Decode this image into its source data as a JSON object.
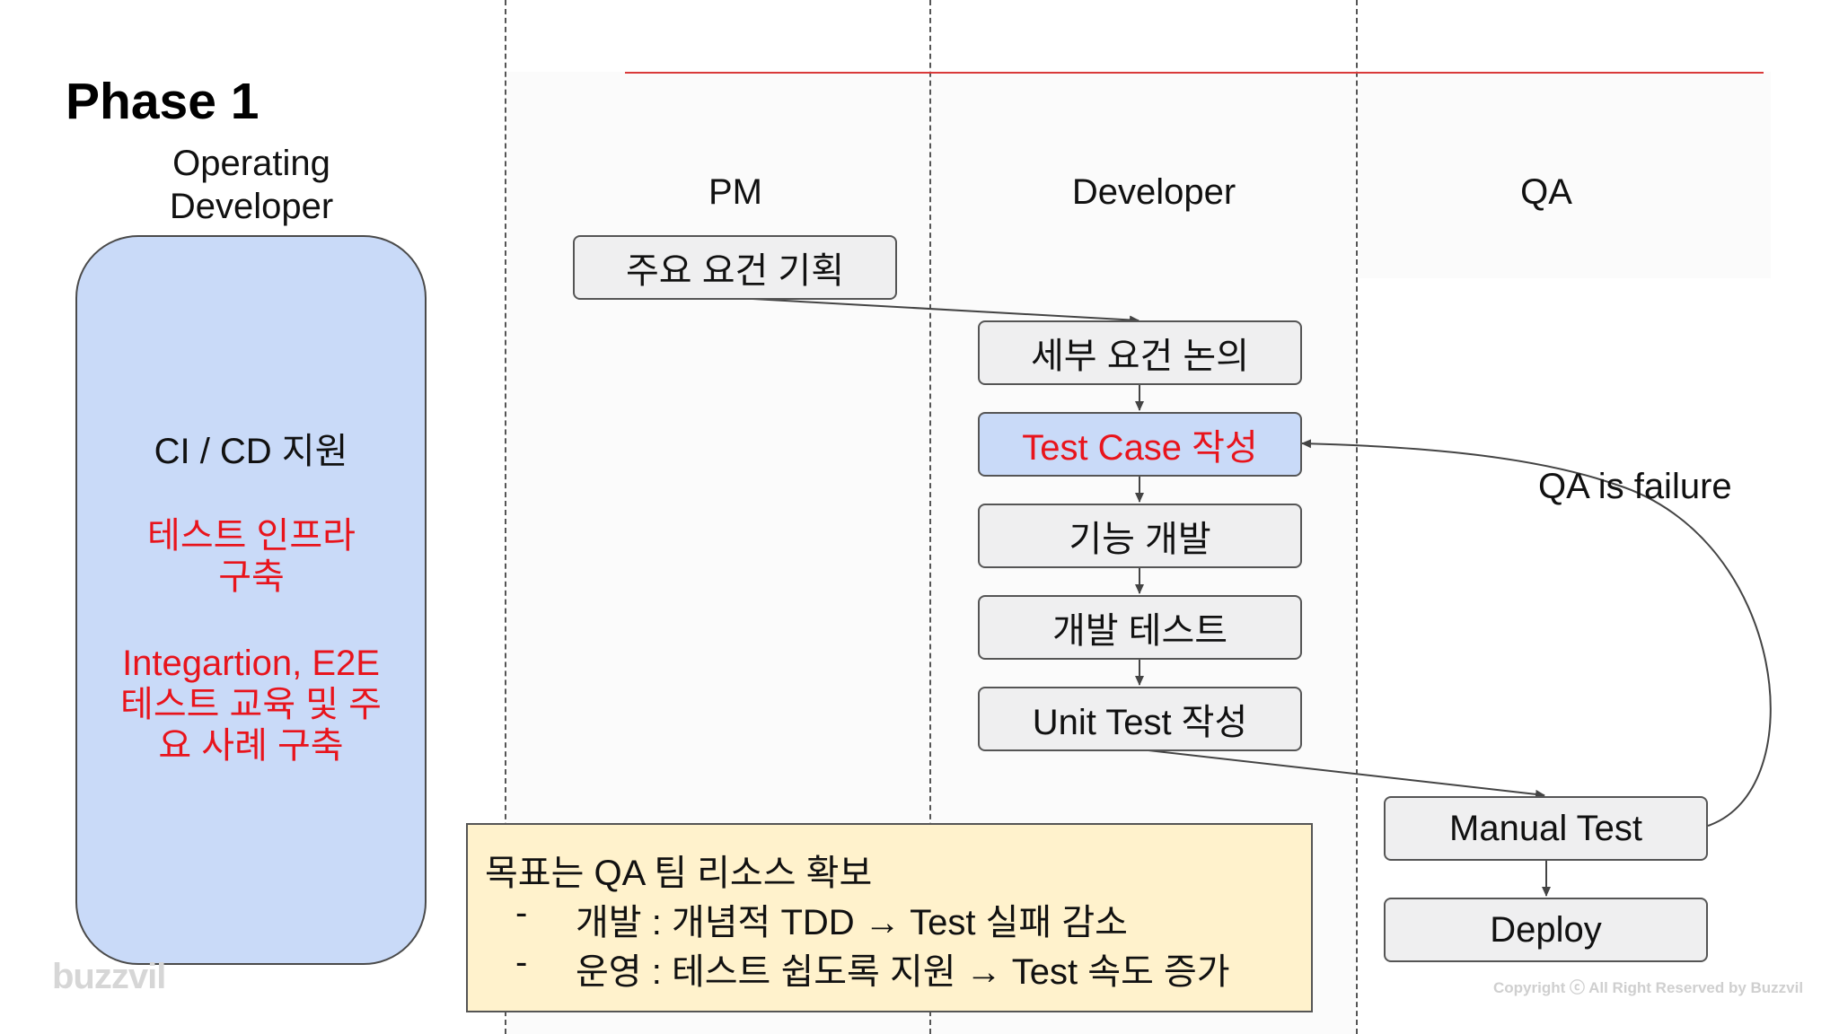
{
  "title": "Phase 1",
  "operating": {
    "title": "Operating Developer",
    "item1": "CI / CD 지원",
    "item2": "테스트 인프라 구축",
    "item3": "Integartion, E2E 테스트 교육 및 주요 사례 구축"
  },
  "lanes": {
    "pm": "PM",
    "developer": "Developer",
    "qa": "QA"
  },
  "nodes": {
    "pm_plan": "주요 요건 기획",
    "dev_discuss": "세부 요건 논의",
    "dev_testcase": "Test Case 작성",
    "dev_feature": "기능 개발",
    "dev_test": "개발 테스트",
    "dev_unit": "Unit Test 작성",
    "qa_manual": "Manual Test",
    "qa_deploy": "Deploy"
  },
  "loop_label": "QA is failure",
  "goal": {
    "title": "목표는 QA 팀 리소스 확보",
    "bullet_marker": "-",
    "items": [
      "개발 : 개념적 TDD → Test 실패 감소",
      "운영 : 테스트 쉽도록 지원 → Test 속도 증가"
    ]
  },
  "logo": "buzzvil",
  "copyright": "Copyright ⓒ All Right Reserved by Buzzvil",
  "colors": {
    "accent_red": "#e8141c",
    "box_blue": "#c9daf8",
    "goal_yellow": "#fff2cc",
    "node_gray": "#efeff0"
  }
}
